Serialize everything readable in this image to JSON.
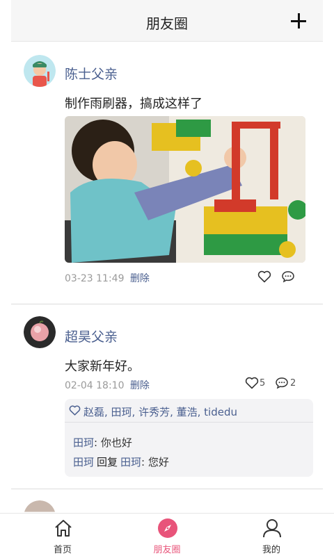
{
  "header": {
    "title": "朋友圈",
    "add_icon": "plus-icon"
  },
  "posts": [
    {
      "author": "陈士父亲",
      "text": "制作雨刷器，搞成这样了",
      "time": "03-23 11:49",
      "delete_label": "删除",
      "has_photo": true
    },
    {
      "author": "超昊父亲",
      "text": "大家新年好。",
      "time": "02-04 18:10",
      "delete_label": "删除",
      "like_count": "5",
      "comment_count": "2",
      "likes": "赵磊, 田珂, 许秀芳, 董浩, tidedu",
      "comments": [
        {
          "name": "田珂",
          "sep": ":",
          "text": "你也好"
        },
        {
          "name": "田珂",
          "reply_word": "回复",
          "reply_to": "田珂",
          "sep": ":",
          "text": "您好"
        }
      ]
    }
  ],
  "tabs": [
    {
      "label": "首页",
      "icon": "home-icon"
    },
    {
      "label": "朋友圈",
      "icon": "compass-icon",
      "active": true
    },
    {
      "label": "我的",
      "icon": "user-icon"
    }
  ],
  "colors": {
    "accent": "#e8547a",
    "link": "#4a5f8f"
  }
}
